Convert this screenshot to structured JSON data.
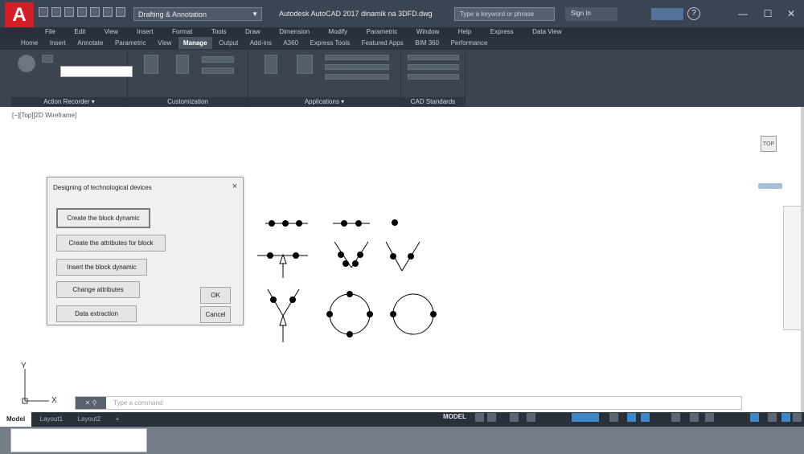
{
  "app": {
    "logo_letter": "A",
    "workspace": "Drafting & Annotation",
    "title": "Autodesk AutoCAD 2017   dinamik na 3DFD.dwg",
    "search_placeholder": "Type a keyword or phrase",
    "signin": "Sign In"
  },
  "menubar": [
    "File",
    "Edit",
    "View",
    "Insert",
    "Format",
    "Tools",
    "Draw",
    "Dimension",
    "Modify",
    "Parametric",
    "Window",
    "Help",
    "Express",
    "Data View"
  ],
  "tabs": [
    "Home",
    "Insert",
    "Annotate",
    "Parametric",
    "View",
    "Manage",
    "Output",
    "Add-ins",
    "A360",
    "Express Tools",
    "Featured Apps",
    "BIM 360",
    "Performance"
  ],
  "active_tab": "Manage",
  "panels": {
    "action_recorder": "Action Recorder ▾",
    "customization": "Customization",
    "applications": "Applications ▾",
    "cad_standards": "CAD Standards"
  },
  "viewport": {
    "label": "[−][Top][2D Wireframe]",
    "viewcube_face": "TOP"
  },
  "dialog": {
    "title": "Designing of technological devices",
    "close": "×",
    "buttons": {
      "create_block": "Create the block dynamic",
      "create_attributes": "Create the attributes for block",
      "insert_block": "Insert the block dynamic",
      "change_attributes": "Change attributes",
      "data_extraction": "Data extraction",
      "ok": "OK",
      "cancel": "Cancel"
    }
  },
  "ucs": {
    "x": "X",
    "y": "Y"
  },
  "cmdline": {
    "placeholder": "Type a command"
  },
  "layout_tabs": [
    "Model",
    "Layout1",
    "Layout2",
    "+"
  ],
  "status": {
    "model": "MODEL"
  },
  "window": {
    "minimize": "—",
    "restore": "☐",
    "close": "✕"
  },
  "colors": {
    "accent": "#d51f26",
    "ribbon_bg": "#3c4450",
    "status_blue": "#3d86c7"
  }
}
